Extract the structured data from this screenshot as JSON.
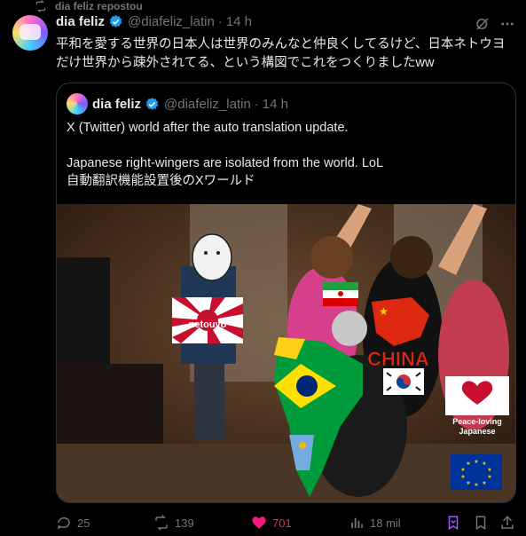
{
  "repost_label": "dia feliz repostou",
  "post": {
    "name": "dia feliz",
    "handle": "@diafeliz_latin",
    "time": "14 h",
    "text": "平和を愛する世界の日本人は世界のみんなと仲良くしてるけど、日本ネトウヨだけ世界から疎外されてる、という構図でこれをつくりましたww"
  },
  "quoted": {
    "name": "dia feliz",
    "handle": "@diafeliz_latin",
    "time": "14 h",
    "line1": "X (Twitter) world after the auto translation update.",
    "line2": "Japanese right-wingers are isolated from the world. LoL",
    "line3": "自動翻訳機能設置後のXワールド"
  },
  "image": {
    "label_netouyo": "netouyo",
    "label_china": "CHINA",
    "label_peace": "Peace-loving Japanese"
  },
  "actions": {
    "replies": "25",
    "reposts": "139",
    "likes": "701",
    "views": "18 mil"
  },
  "colors": {
    "accent_blue": "#1d9bf0",
    "like_pink": "#f91880",
    "muted": "#71767b"
  }
}
